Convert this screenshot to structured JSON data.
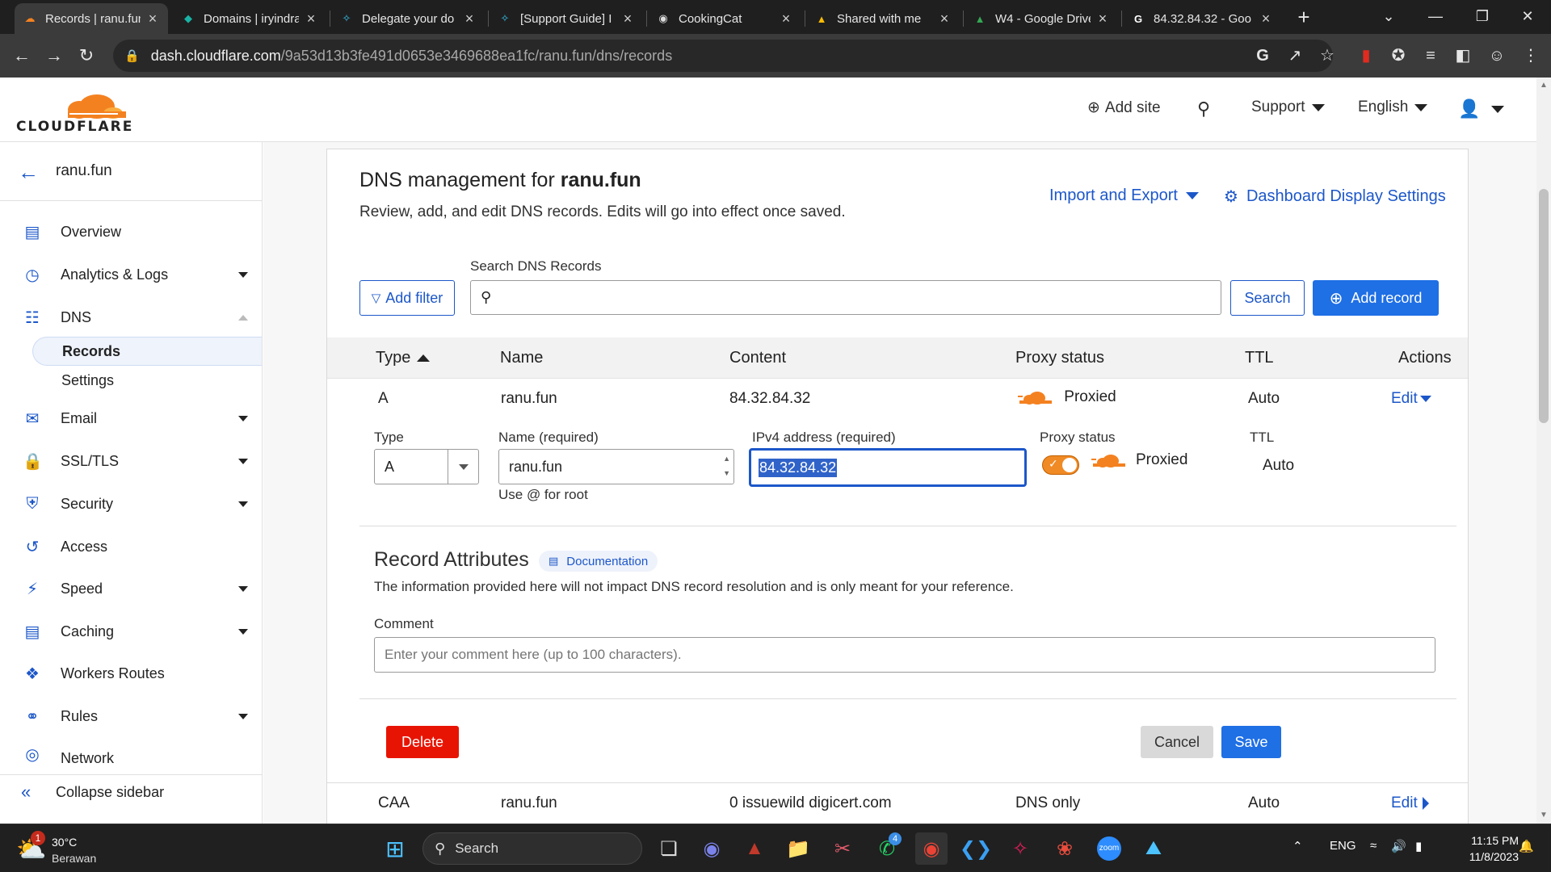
{
  "browser": {
    "tabs": [
      {
        "title": "Records | ranu.fun",
        "icon": "cloudflare-icon",
        "active": true
      },
      {
        "title": "Domains | iryindra",
        "icon": "domain-icon",
        "active": false
      },
      {
        "title": "Delegate your do",
        "icon": "slack-icon",
        "active": false
      },
      {
        "title": "[Support Guide] I",
        "icon": "slack-icon",
        "active": false
      },
      {
        "title": "CookingCat",
        "icon": "github-icon",
        "active": false
      },
      {
        "title": "Shared with me",
        "icon": "google-drive-icon",
        "active": false
      },
      {
        "title": "W4 - Google Drive",
        "icon": "google-drive-icon",
        "active": false
      },
      {
        "title": "84.32.84.32 - Goo",
        "icon": "google-icon",
        "active": false
      }
    ],
    "new_tab": "+",
    "url_host": "dash.cloudflare.com",
    "url_path": "/9a53d13b3fe491d0653e3469688ea1fc/ranu.fun/dns/records"
  },
  "header": {
    "logo_text": "CLOUDFLARE",
    "add_site": "Add site",
    "support": "Support",
    "language": "English"
  },
  "sidebar": {
    "zone": "ranu.fun",
    "items": [
      {
        "label": "Overview",
        "icon": "overview-icon"
      },
      {
        "label": "Analytics & Logs",
        "icon": "analytics-icon"
      },
      {
        "label": "DNS",
        "icon": "dns-icon"
      },
      {
        "label": "Email",
        "icon": "email-icon"
      },
      {
        "label": "SSL/TLS",
        "icon": "lock-icon"
      },
      {
        "label": "Security",
        "icon": "shield-icon"
      },
      {
        "label": "Access",
        "icon": "access-icon"
      },
      {
        "label": "Speed",
        "icon": "bolt-icon"
      },
      {
        "label": "Caching",
        "icon": "caching-icon"
      },
      {
        "label": "Workers Routes",
        "icon": "workers-icon"
      },
      {
        "label": "Rules",
        "icon": "rules-icon"
      },
      {
        "label": "Network",
        "icon": "network-icon"
      }
    ],
    "dns_sub": {
      "records": "Records",
      "settings": "Settings"
    },
    "collapse": "Collapse sidebar"
  },
  "main": {
    "title_prefix": "DNS management for ",
    "title_zone": "ranu.fun",
    "subtitle": "Review, add, and edit DNS records. Edits will go into effect once saved.",
    "import_export": "Import and Export",
    "display_settings": "Dashboard Display Settings",
    "add_filter": "Add filter",
    "search_label": "Search DNS Records",
    "search_button": "Search",
    "add_record": "Add record",
    "columns": {
      "type": "Type",
      "name": "Name",
      "content": "Content",
      "proxy": "Proxy status",
      "ttl": "TTL",
      "actions": "Actions"
    },
    "record1": {
      "type": "A",
      "name": "ranu.fun",
      "content": "84.32.84.32",
      "proxy": "Proxied",
      "ttl": "Auto",
      "edit": "Edit"
    },
    "form": {
      "type_label": "Type",
      "type_value": "A",
      "name_label": "Name (required)",
      "name_value": "ranu.fun",
      "name_hint": "Use @ for root",
      "ip_label": "IPv4 address (required)",
      "ip_value": "84.32.84.32",
      "proxy_label": "Proxy status",
      "proxy_value": "Proxied",
      "ttl_label": "TTL",
      "ttl_value": "Auto"
    },
    "attributes": {
      "title": "Record Attributes",
      "doc_link": "Documentation",
      "subtitle": "The information provided here will not impact DNS record resolution and is only meant for your reference.",
      "comment_label": "Comment",
      "comment_placeholder": "Enter your comment here (up to 100 characters)."
    },
    "buttons": {
      "delete": "Delete",
      "cancel": "Cancel",
      "save": "Save"
    },
    "record2": {
      "type": "CAA",
      "name": "ranu.fun",
      "content": "0 issuewild digicert.com",
      "proxy": "DNS only",
      "ttl": "Auto",
      "edit": "Edit"
    }
  },
  "taskbar": {
    "weather_badge": "1",
    "temp": "30°C",
    "condition": "Berawan",
    "search": "Search",
    "whatsapp_badge": "4",
    "lang": "ENG",
    "time": "11:15 PM",
    "date": "11/8/2023"
  },
  "colors": {
    "accent": "#1f6fe5",
    "link": "#1c57c9",
    "cloud_orange": "#f48120",
    "delete_red": "#e81403"
  }
}
